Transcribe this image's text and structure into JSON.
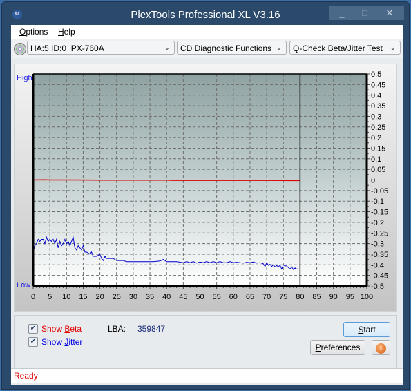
{
  "window": {
    "title": "PlexTools Professional XL V3.16",
    "icon": "xl-app-icon",
    "controls": {
      "minimize": "_",
      "maximize": "□",
      "close": "✕"
    }
  },
  "menu": [
    {
      "label": "Options",
      "accel": "O"
    },
    {
      "label": "Help",
      "accel": "H"
    }
  ],
  "toolbar": {
    "drive_icon": "cd-drive-icon",
    "drive": "HA:5 ID:0  PX-760A",
    "function": "CD Diagnostic Functions",
    "test": "Q-Check Beta/Jitter Test"
  },
  "chart_data": {
    "type": "line",
    "title": "",
    "left_axis_labels": {
      "top": "High",
      "bottom": "Low"
    },
    "xlabel": "",
    "ylabel": "",
    "xlim": [
      0,
      100
    ],
    "ylim": [
      -0.5,
      0.5
    ],
    "x_ticks": [
      0,
      5,
      10,
      15,
      20,
      25,
      30,
      35,
      40,
      45,
      50,
      55,
      60,
      65,
      70,
      75,
      80,
      85,
      90,
      95,
      100
    ],
    "y_ticks": [
      0.5,
      0.45,
      0.4,
      0.35,
      0.3,
      0.25,
      0.2,
      0.15,
      0.1,
      0.05,
      0,
      -0.05,
      -0.1,
      -0.15,
      -0.2,
      -0.25,
      -0.3,
      -0.35,
      -0.4,
      -0.45,
      -0.5
    ],
    "y_tick_labels": [
      "0.5",
      "0.45",
      "0.4",
      "0.35",
      "0.3",
      "0.25",
      "0.2",
      "0.15",
      "0.1",
      "0.05",
      "0",
      "-0.05",
      "-0.1",
      "-0.15",
      "-0.2",
      "-0.25",
      "-0.3",
      "-0.35",
      "-0.4",
      "-0.45",
      "-0.5"
    ],
    "grid": true,
    "end_marker_x": 80,
    "series": [
      {
        "name": "Beta",
        "color": "#e00000",
        "x": [
          0,
          3,
          6,
          10,
          12,
          20,
          40,
          42,
          45,
          60,
          70,
          79,
          80
        ],
        "y": [
          0.0,
          0.001,
          0.0,
          0.0,
          0.0,
          -0.001,
          -0.001,
          -0.002,
          -0.002,
          -0.002,
          -0.002,
          -0.003,
          -0.002
        ]
      },
      {
        "name": "Jitter",
        "color": "#0000c8",
        "x": [
          0,
          0.5,
          1,
          1.5,
          2,
          2.5,
          3,
          3.5,
          4,
          4.5,
          5,
          5.5,
          6,
          6.5,
          7,
          7.5,
          8,
          8.5,
          9,
          9.5,
          10,
          10.5,
          11,
          11.5,
          12,
          12.5,
          13,
          13.5,
          14,
          14.5,
          15,
          15.5,
          16,
          17,
          17.5,
          18,
          19,
          20,
          20.5,
          21,
          21.5,
          22,
          23,
          24,
          25,
          26,
          27,
          28,
          30,
          32,
          34,
          36,
          38,
          39,
          40,
          41,
          43,
          45,
          46,
          47,
          48,
          49,
          50,
          51,
          52,
          53,
          54,
          55,
          56,
          57,
          58,
          59,
          60,
          61,
          62,
          63,
          64,
          65,
          66,
          67,
          68,
          69,
          69.5,
          70,
          70.5,
          71,
          71.5,
          72,
          72.5,
          73,
          73.5,
          74,
          74.5,
          75,
          75.5,
          76,
          76.5,
          77,
          77.5,
          78,
          78.5,
          79,
          79.5
        ],
        "y": [
          -0.34,
          -0.31,
          -0.3,
          -0.28,
          -0.29,
          -0.28,
          -0.28,
          -0.3,
          -0.27,
          -0.29,
          -0.28,
          -0.29,
          -0.28,
          -0.3,
          -0.28,
          -0.32,
          -0.29,
          -0.31,
          -0.3,
          -0.28,
          -0.3,
          -0.29,
          -0.31,
          -0.29,
          -0.27,
          -0.32,
          -0.33,
          -0.31,
          -0.32,
          -0.33,
          -0.31,
          -0.34,
          -0.34,
          -0.35,
          -0.34,
          -0.36,
          -0.36,
          -0.35,
          -0.37,
          -0.38,
          -0.36,
          -0.37,
          -0.37,
          -0.37,
          -0.38,
          -0.38,
          -0.38,
          -0.385,
          -0.385,
          -0.385,
          -0.385,
          -0.385,
          -0.382,
          -0.375,
          -0.385,
          -0.385,
          -0.385,
          -0.39,
          -0.385,
          -0.39,
          -0.385,
          -0.392,
          -0.387,
          -0.39,
          -0.385,
          -0.39,
          -0.385,
          -0.39,
          -0.385,
          -0.39,
          -0.39,
          -0.385,
          -0.39,
          -0.388,
          -0.39,
          -0.392,
          -0.388,
          -0.39,
          -0.387,
          -0.392,
          -0.39,
          -0.395,
          -0.408,
          -0.39,
          -0.402,
          -0.398,
          -0.408,
          -0.4,
          -0.41,
          -0.403,
          -0.41,
          -0.402,
          -0.42,
          -0.4,
          -0.405,
          -0.405,
          -0.413,
          -0.42,
          -0.41,
          -0.422,
          -0.415,
          -0.42,
          -0.418
        ]
      }
    ]
  },
  "options": {
    "show_beta": {
      "label": "Show Beta",
      "accel": "B",
      "checked": true,
      "color": "#e00000"
    },
    "show_jitter": {
      "label": "Show Jitter",
      "accel": "J",
      "checked": true,
      "color": "#0000e0"
    },
    "lba_label": "LBA:",
    "lba_value": "359847"
  },
  "buttons": {
    "start": "Start",
    "preferences": "Preferences",
    "info_icon": "info-icon"
  },
  "status": "Ready"
}
